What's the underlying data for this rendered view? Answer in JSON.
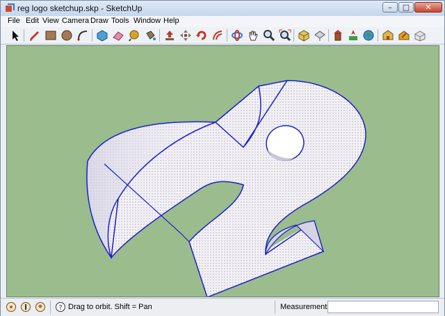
{
  "window": {
    "title": "reg logo sketchup.skp - SketchUp"
  },
  "menu": [
    "File",
    "Edit",
    "View",
    "Camera",
    "Draw",
    "Tools",
    "Window",
    "Help"
  ],
  "toolbar": {
    "tools": [
      "select-arrow-icon",
      "line-pencil-icon",
      "rectangle-icon",
      "circle-icon",
      "arc-icon",
      "make-component-icon",
      "eraser-icon",
      "tape-measure-icon",
      "paint-bucket-icon",
      "push-pull-icon",
      "move-icon",
      "rotate-icon",
      "offset-icon",
      "orbit-icon",
      "pan-icon",
      "zoom-icon",
      "zoom-extents-icon",
      "iso-view-icon",
      "top-view-icon",
      "previous-view-icon",
      "add-location-icon",
      "toggle-terrain-icon",
      "warehouse-icon",
      "share-model-icon",
      "component-gallery-icon",
      "styles-icon"
    ]
  },
  "colors": {
    "viewport_bg": "#9bbc8d",
    "edge": "#1a1fc9",
    "face": "#f2f0f5"
  },
  "status": {
    "message": "Drag to orbit.  Shift = Pan",
    "measurements_label": "Measurements",
    "measurements_value": "",
    "icons": [
      "geo-location-icon",
      "credits-icon",
      "user-icon",
      "help-icon"
    ]
  }
}
